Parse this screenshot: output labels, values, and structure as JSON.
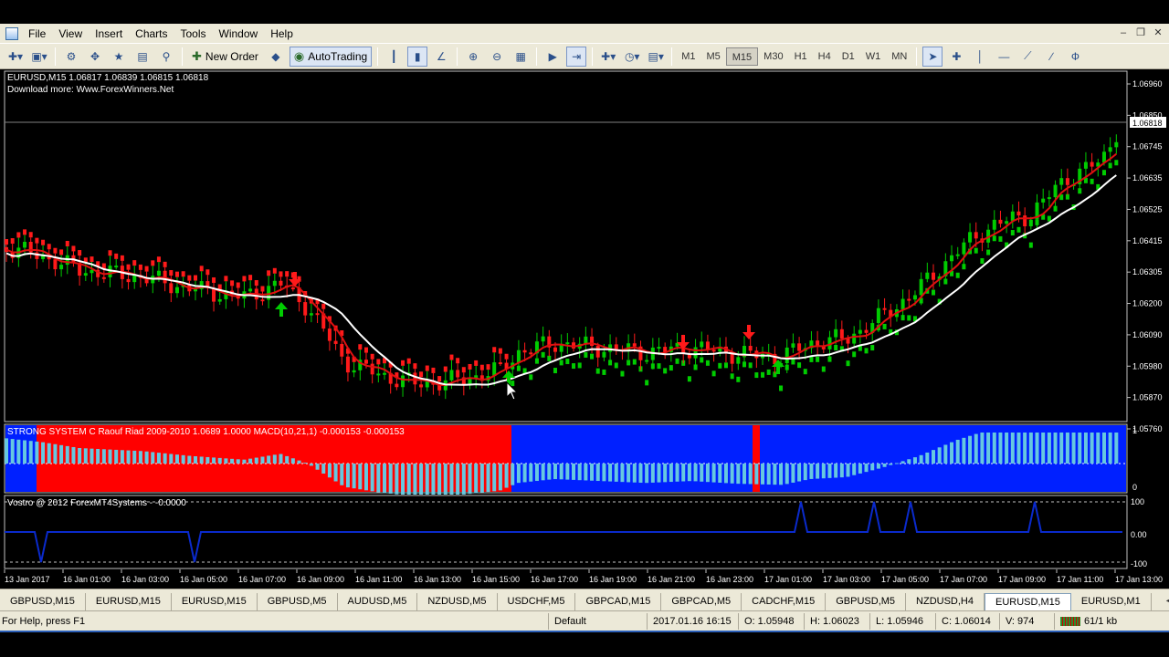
{
  "menu": [
    "File",
    "View",
    "Insert",
    "Charts",
    "Tools",
    "Window",
    "Help"
  ],
  "toolbar": {
    "new_order": "New Order",
    "autotrading": "AutoTrading"
  },
  "timeframes": [
    "M1",
    "M5",
    "M15",
    "M30",
    "H1",
    "H4",
    "D1",
    "W1",
    "MN"
  ],
  "active_timeframe": "M15",
  "chart": {
    "header": "EURUSD,M15  1.06817 1.06839 1.06815 1.06818",
    "subheader": "Download more: Www.ForexWinners.Net",
    "price_labels": [
      "1.06960",
      "1.06850",
      "1.06745",
      "1.06635",
      "1.06525",
      "1.06415",
      "1.06305",
      "1.06200",
      "1.06090",
      "1.05980",
      "1.05870",
      "1.05760"
    ],
    "current_price": "1.06818",
    "indicator1_label": "STRONG SYSTEM C Raouf Riad 2009-2010  1.0689 1.0000  MACD(10,21,1) -0.000153 -0.000153",
    "indicator1_scale": [
      "1",
      "0"
    ],
    "indicator2_label": "Vostro @ 2012 ForexMT4Systems - -0.0000",
    "indicator2_scale": [
      "100",
      "0.00",
      "-100"
    ],
    "time_labels": [
      "13 Jan 2017",
      "16 Jan 01:00",
      "16 Jan 03:00",
      "16 Jan 05:00",
      "16 Jan 07:00",
      "16 Jan 09:00",
      "16 Jan 11:00",
      "16 Jan 13:00",
      "16 Jan 15:00",
      "16 Jan 17:00",
      "16 Jan 19:00",
      "16 Jan 21:00",
      "16 Jan 23:00",
      "17 Jan 01:00",
      "17 Jan 03:00",
      "17 Jan 05:00",
      "17 Jan 07:00",
      "17 Jan 09:00",
      "17 Jan 11:00",
      "17 Jan 13:00"
    ]
  },
  "tabs": [
    "GBPUSD,M15",
    "EURUSD,M15",
    "EURUSD,M15",
    "GBPUSD,M5",
    "AUDUSD,M5",
    "NZDUSD,M5",
    "USDCHF,M5",
    "GBPCAD,M15",
    "GBPCAD,M5",
    "CADCHF,M15",
    "GBPUSD,M5",
    "NZDUSD,H4",
    "EURUSD,M15",
    "EURUSD,M1"
  ],
  "active_tab_index": 12,
  "status": {
    "help": "For Help, press F1",
    "profile": "Default",
    "datetime": "2017.01.16 16:15",
    "open": "O: 1.05948",
    "high": "H: 1.06023",
    "low": "L: 1.05946",
    "close": "C: 1.06014",
    "volume": "V: 974",
    "traffic": "61/1 kb"
  },
  "colors": {
    "bull": "#00cc00",
    "bear": "#ff1a1a",
    "fast_ma": "#e01010",
    "slow_ma": "#ffffff",
    "ind_blue": "#0020ff",
    "ind_red": "#ff0000",
    "hist": "#66c8e0"
  }
}
